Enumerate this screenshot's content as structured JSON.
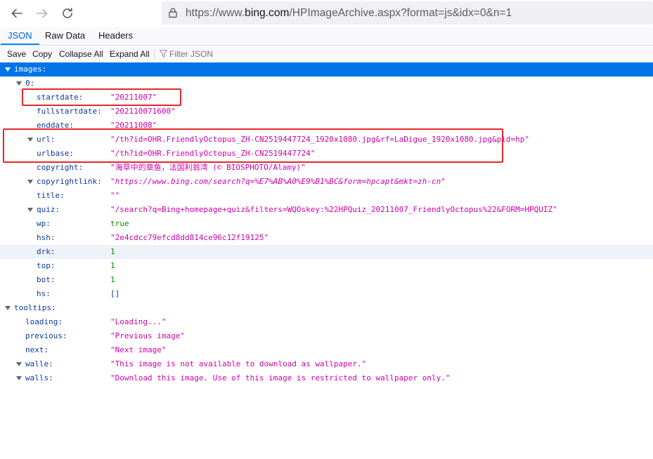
{
  "browser": {
    "url_prefix": "https://www.",
    "url_domain": "bing.com",
    "url_path": "/HPImageArchive.aspx?format=js&idx=0&n=1"
  },
  "tabs": [
    "JSON",
    "Raw Data",
    "Headers"
  ],
  "toolbar": {
    "save": "Save",
    "copy": "Copy",
    "collapse_all": "Collapse All",
    "expand_all": "Expand All",
    "filter_placeholder": "Filter JSON"
  },
  "tree": [
    {
      "key": "images:",
      "depth": 0,
      "twisty": true,
      "value": "",
      "type": "",
      "selected": true
    },
    {
      "key": "0:",
      "depth": 1,
      "twisty": true,
      "value": "",
      "type": ""
    },
    {
      "key": "startdate:",
      "depth": 2,
      "twisty": false,
      "value": "\"20211007\"",
      "type": "str"
    },
    {
      "key": "fullstartdate:",
      "depth": 2,
      "twisty": false,
      "value": "\"202110071600\"",
      "type": "str"
    },
    {
      "key": "enddate:",
      "depth": 2,
      "twisty": false,
      "value": "\"20211008\"",
      "type": "str"
    },
    {
      "key": "url:",
      "depth": 2,
      "twisty": true,
      "value": "\"/th?id=OHR.FriendlyOctopus_ZH-CN2519447724_1920x1080.jpg&rf=LaDigue_1920x1080.jpg&pid=hp\"",
      "type": "str"
    },
    {
      "key": "urlbase:",
      "depth": 2,
      "twisty": false,
      "value": "\"/th?id=OHR.FriendlyOctopus_ZH-CN2519447724\"",
      "type": "str"
    },
    {
      "key": "copyright:",
      "depth": 2,
      "twisty": false,
      "value": "\"海草中的章鱼，法国利翁湾 (© BIOSPHOTO/Alamy)\"",
      "type": "str"
    },
    {
      "key": "copyrightlink:",
      "depth": 2,
      "twisty": true,
      "value": "\"https://www.bing.com/search?q=%E7%AB%A0%E9%B1%BC&form=hpcapt&mkt=zh-cn\"",
      "type": "str",
      "italic": true
    },
    {
      "key": "title:",
      "depth": 2,
      "twisty": false,
      "value": "\"\"",
      "type": "str"
    },
    {
      "key": "quiz:",
      "depth": 2,
      "twisty": true,
      "value": "\"/search?q=Bing+homepage+quiz&filters=WQOskey:%22HPQuiz_20211007_FriendlyOctopus%22&FORM=HPQUIZ\"",
      "type": "str"
    },
    {
      "key": "wp:",
      "depth": 2,
      "twisty": false,
      "value": "true",
      "type": "bool"
    },
    {
      "key": "hsh:",
      "depth": 2,
      "twisty": false,
      "value": "\"2e4cdcc79efcd8dd814ce96c12f19125\"",
      "type": "str"
    },
    {
      "key": "drk:",
      "depth": 2,
      "twisty": false,
      "value": "1",
      "type": "num",
      "hover": true
    },
    {
      "key": "top:",
      "depth": 2,
      "twisty": false,
      "value": "1",
      "type": "num"
    },
    {
      "key": "bot:",
      "depth": 2,
      "twisty": false,
      "value": "1",
      "type": "num"
    },
    {
      "key": "hs:",
      "depth": 2,
      "twisty": false,
      "value": "[]",
      "type": "arr"
    },
    {
      "key": "tooltips:",
      "depth": 0,
      "twisty": true,
      "value": "",
      "type": ""
    },
    {
      "key": "loading:",
      "depth": 1,
      "twisty": false,
      "value": "\"Loading...\"",
      "type": "str"
    },
    {
      "key": "previous:",
      "depth": 1,
      "twisty": false,
      "value": "\"Previous image\"",
      "type": "str"
    },
    {
      "key": "next:",
      "depth": 1,
      "twisty": false,
      "value": "\"Next image\"",
      "type": "str"
    },
    {
      "key": "walle:",
      "depth": 1,
      "twisty": true,
      "value": "\"This image is not available to download as wallpaper.\"",
      "type": "str"
    },
    {
      "key": "walls:",
      "depth": 1,
      "twisty": true,
      "value": "\"Download this image. Use of this image is restricted to wallpaper only.\"",
      "type": "str"
    }
  ],
  "colors": {
    "selected_row": "#0074e8",
    "key": "#0b3a9b",
    "string": "#cc00aa",
    "number": "#058b00",
    "highlight": "#e8262a"
  }
}
